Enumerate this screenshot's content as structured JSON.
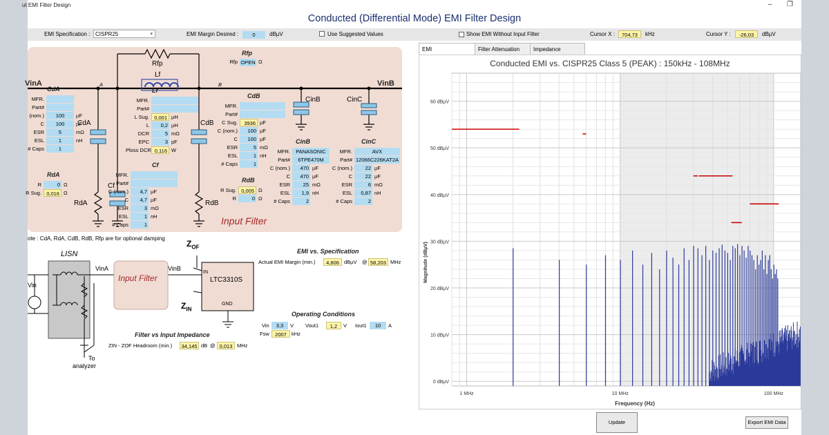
{
  "window": {
    "title": "ut EMI Filter Design",
    "app_title": "Conducted (Differential Mode) EMI Filter Design",
    "minimize": "–",
    "restore": "❐"
  },
  "toolbar": {
    "emi_spec_label": "EMI Specification :",
    "emi_spec_value": "CISPR25",
    "margin_label": "EMI Margin Desired :",
    "margin_value": "0",
    "margin_unit": "dBµV",
    "suggested_label": "Use Suggested Values",
    "show_emi_label": "Show EMI Without Input Filter",
    "cursor_x_label": "Cursor X :",
    "cursor_x_value": "704,73",
    "cursor_x_unit": "kHz",
    "cursor_y_label": "Cursor Y :",
    "cursor_y_value": "-26,03",
    "cursor_y_unit": "dBµV"
  },
  "schematic": {
    "vina": "VinA",
    "vinb": "VinB",
    "node_a": "A",
    "node_b": "B",
    "rfp_label": "Rfp",
    "lf_label": "Lf",
    "cda_label": "CdA",
    "cdb_label": "CdB",
    "cinb_label": "CinB",
    "cinc_label": "CinC",
    "cf_label": "Cf",
    "rda_label": "RdA",
    "rdb_label": "RdB",
    "section_label": "Input Filter",
    "rfp": {
      "title": "Rfp",
      "label": "Rfp",
      "value": "OPEN",
      "unit": "Ω"
    },
    "cda": {
      "title": "CdA",
      "rows": [
        {
          "label": "MFR.",
          "value": "",
          "unit": ""
        },
        {
          "label": "Part#",
          "value": "",
          "unit": ""
        },
        {
          "label": "(nom.)",
          "value": "100",
          "unit": "µF"
        },
        {
          "label": "C",
          "value": "100",
          "unit": "µF"
        },
        {
          "label": "ESR",
          "value": "5",
          "unit": "mΩ"
        },
        {
          "label": "ESL",
          "value": "1",
          "unit": "nH"
        },
        {
          "label": "# Caps",
          "value": "1",
          "unit": ""
        }
      ]
    },
    "lf": {
      "title": "Lf",
      "rows": [
        {
          "label": "MFR.",
          "value": "",
          "unit": ""
        },
        {
          "label": "Part#",
          "value": "",
          "unit": ""
        },
        {
          "label": "L Sug.",
          "value": "0,001",
          "unit": "µH"
        },
        {
          "label": "L",
          "value": "0,2",
          "unit": "µH"
        },
        {
          "label": "DCR",
          "value": "5",
          "unit": "mΩ"
        },
        {
          "label": "EPC",
          "value": "3",
          "unit": "pF"
        },
        {
          "label": "Ploss DCR",
          "value": "0,116",
          "unit": "W"
        }
      ]
    },
    "cdb": {
      "title": "CdB",
      "rows": [
        {
          "label": "MFR.",
          "value": "",
          "unit": ""
        },
        {
          "label": "Part#",
          "value": "",
          "unit": ""
        },
        {
          "label": "C Sug.",
          "value": "3936",
          "unit": "µF"
        },
        {
          "label": "C (nom.)",
          "value": "100",
          "unit": "µF"
        },
        {
          "label": "C",
          "value": "100",
          "unit": "µF"
        },
        {
          "label": "ESR",
          "value": "5",
          "unit": "mΩ"
        },
        {
          "label": "ESL",
          "value": "1",
          "unit": "nH"
        },
        {
          "label": "# Caps",
          "value": "1",
          "unit": ""
        }
      ]
    },
    "cinb": {
      "title": "CinB",
      "rows": [
        {
          "label": "MFR.",
          "value": "PANASONIC",
          "unit": ""
        },
        {
          "label": "Part#",
          "value": "6TPE470M",
          "unit": ""
        },
        {
          "label": "C (nom.)",
          "value": "470",
          "unit": "µF"
        },
        {
          "label": "C",
          "value": "470",
          "unit": "µF"
        },
        {
          "label": "ESR",
          "value": "25",
          "unit": "mΩ"
        },
        {
          "label": "ESL",
          "value": "1,9",
          "unit": "nH"
        },
        {
          "label": "# Caps",
          "value": "2",
          "unit": ""
        }
      ]
    },
    "cinc": {
      "title": "CinC",
      "rows": [
        {
          "label": "MFR.",
          "value": "AVX",
          "unit": ""
        },
        {
          "label": "Part#",
          "value": "12066C226KAT2A",
          "unit": ""
        },
        {
          "label": "C (nom.)",
          "value": "22",
          "unit": "µF"
        },
        {
          "label": "C",
          "value": "22",
          "unit": "µF"
        },
        {
          "label": "ESR",
          "value": "6",
          "unit": "mΩ"
        },
        {
          "label": "ESL",
          "value": "0,87",
          "unit": "nH"
        },
        {
          "label": "# Caps",
          "value": "2",
          "unit": ""
        }
      ]
    },
    "rda": {
      "title": "RdA",
      "rows": [
        {
          "label": "R",
          "value": "0",
          "unit": "Ω"
        },
        {
          "label": "R Sug.",
          "value": "0,016",
          "unit": "Ω"
        }
      ]
    },
    "rdb": {
      "title": "RdB",
      "rows": [
        {
          "label": "R Sug.",
          "value": "0,005",
          "unit": "Ω"
        },
        {
          "label": "R",
          "value": "0",
          "unit": "Ω"
        }
      ]
    },
    "cf": {
      "title": "Cf",
      "rows": [
        {
          "label": "MFR.",
          "value": "",
          "unit": ""
        },
        {
          "label": "Part#",
          "value": "",
          "unit": ""
        },
        {
          "label": "C (nom.)",
          "value": "4,7",
          "unit": "µF"
        },
        {
          "label": "C",
          "value": "4,7",
          "unit": "µF"
        },
        {
          "label": "ESR",
          "value": "3",
          "unit": "mΩ"
        },
        {
          "label": "ESL",
          "value": "1",
          "unit": "nH"
        },
        {
          "label": "# Caps",
          "value": "1",
          "unit": ""
        }
      ]
    }
  },
  "note": "ote : CdA, RdA, CdB, RdB, Rfp are for optional damping",
  "block": {
    "lisn": "LISN",
    "vin": "Vin",
    "vina": "VinA",
    "vinb": "VinB",
    "input_filter": "Input Filter",
    "zof": "Z",
    "zof_sub": "OF",
    "zin": "Z",
    "zin_sub": "IN",
    "chip": "LTC3310S",
    "in": "IN",
    "gnd": "GND",
    "to": "To",
    "analyzer": "analyzer"
  },
  "emi_vs_spec": {
    "title": "EMI vs. Specification",
    "label": "Actual EMI Margin (min.)",
    "value": "4,606",
    "unit": "dBµV",
    "at": "@",
    "freq": "58,203",
    "freq_unit": "MHz"
  },
  "operating": {
    "title": "Operating Conditions",
    "vin_label": "Vin",
    "vin_value": "3,3",
    "vin_unit": "V",
    "vout_label": "Vout1",
    "vout_value": "1,2",
    "vout_unit": "V",
    "iout_label": "Iout1",
    "iout_value": "10",
    "iout_unit": "A",
    "fsw_label": "Fsw",
    "fsw_value": "2007",
    "fsw_unit": "kHz"
  },
  "impedance": {
    "title": "Filter vs Input Impedance",
    "label": "ZIN - ZOF Headroom (min.)",
    "value": "34,145",
    "unit": "dB",
    "at": "@",
    "freq": "0,013",
    "freq_unit": "MHz"
  },
  "tabs": [
    {
      "label": "EMI"
    },
    {
      "label": "Filter Attenuation"
    },
    {
      "label": "Impedance"
    }
  ],
  "buttons": {
    "update": "Update",
    "export": "Export EMI Data"
  },
  "colors": {
    "limit": "#cc0000",
    "spectrum": "#2b3a9a",
    "schematic_bg": "#f1dcd3",
    "title": "#1a2f6e"
  },
  "chart_data": {
    "type": "line",
    "title": "Conducted EMI vs. CISPR25 Class 5 (PEAK) : 150kHz - 108MHz",
    "xlabel": "Frequency (Hz)",
    "ylabel": "Magnitude (dBµV)",
    "x_scale": "log",
    "x_tick_labels": [
      "1 MHz",
      "10 MHz",
      "100 MHz"
    ],
    "x_ticks": [
      1,
      10,
      100
    ],
    "y_tick_labels": [
      "0 dBµV",
      "10 dBµV",
      "20 dBµV",
      "30 dBµV",
      "40 dBµV",
      "50 dBµV",
      "60 dBµV"
    ],
    "y_ticks": [
      0,
      10,
      20,
      30,
      40,
      50,
      60
    ],
    "xlim_mhz": [
      0.8,
      150
    ],
    "ylim": [
      -1,
      66
    ],
    "grid": true,
    "series": [
      {
        "kind": "limit",
        "segments": [
          {
            "x": [
              0.8,
              2.2
            ],
            "y": 54
          },
          {
            "x": [
              5.7,
              6.0
            ],
            "y": 53
          },
          {
            "x": [
              30,
              32
            ],
            "y": 44
          },
          {
            "x": [
              32.5,
              54
            ],
            "y": 44
          },
          {
            "x": [
              53,
              62
            ],
            "y": 34
          },
          {
            "x": [
              70,
              108
            ],
            "y": 38
          }
        ]
      },
      {
        "kind": "spectrum",
        "harmonics_mhz": [
          2.007,
          4.014,
          6.021,
          8.028,
          10.035,
          12.042,
          14.049,
          16.056,
          18.063,
          20.07,
          22.077,
          24.084,
          26.091,
          28.098,
          30.105,
          32.112,
          34.119,
          36.126,
          38.133,
          40.14,
          42.147,
          44.154,
          46.161,
          48.168,
          50.175,
          52.182,
          54.189,
          56.196,
          58.203,
          60.21,
          62.217,
          64.224,
          66.231,
          68.238,
          70.245,
          72.252,
          74.259,
          76.266,
          78.273,
          80.28,
          82.287,
          84.294,
          86.301,
          88.308,
          90.315,
          92.322,
          94.329,
          96.336,
          98.343,
          100.35,
          102.357,
          104.364,
          106.371
        ],
        "peak_dbuv": [
          28.5,
          26,
          25,
          27,
          26,
          28,
          25,
          27.5,
          24,
          28,
          26.5,
          25,
          28.5,
          26,
          29,
          28.5,
          27,
          29,
          26,
          28,
          27.5,
          28.5,
          29.3,
          28,
          27.5,
          26,
          29,
          28.5,
          29.4,
          27,
          29,
          28,
          26.5,
          29,
          28,
          27,
          26,
          24,
          27,
          25,
          26,
          28,
          24,
          27,
          23,
          26,
          27,
          24,
          22,
          25,
          23,
          24,
          22
        ]
      }
    ]
  }
}
